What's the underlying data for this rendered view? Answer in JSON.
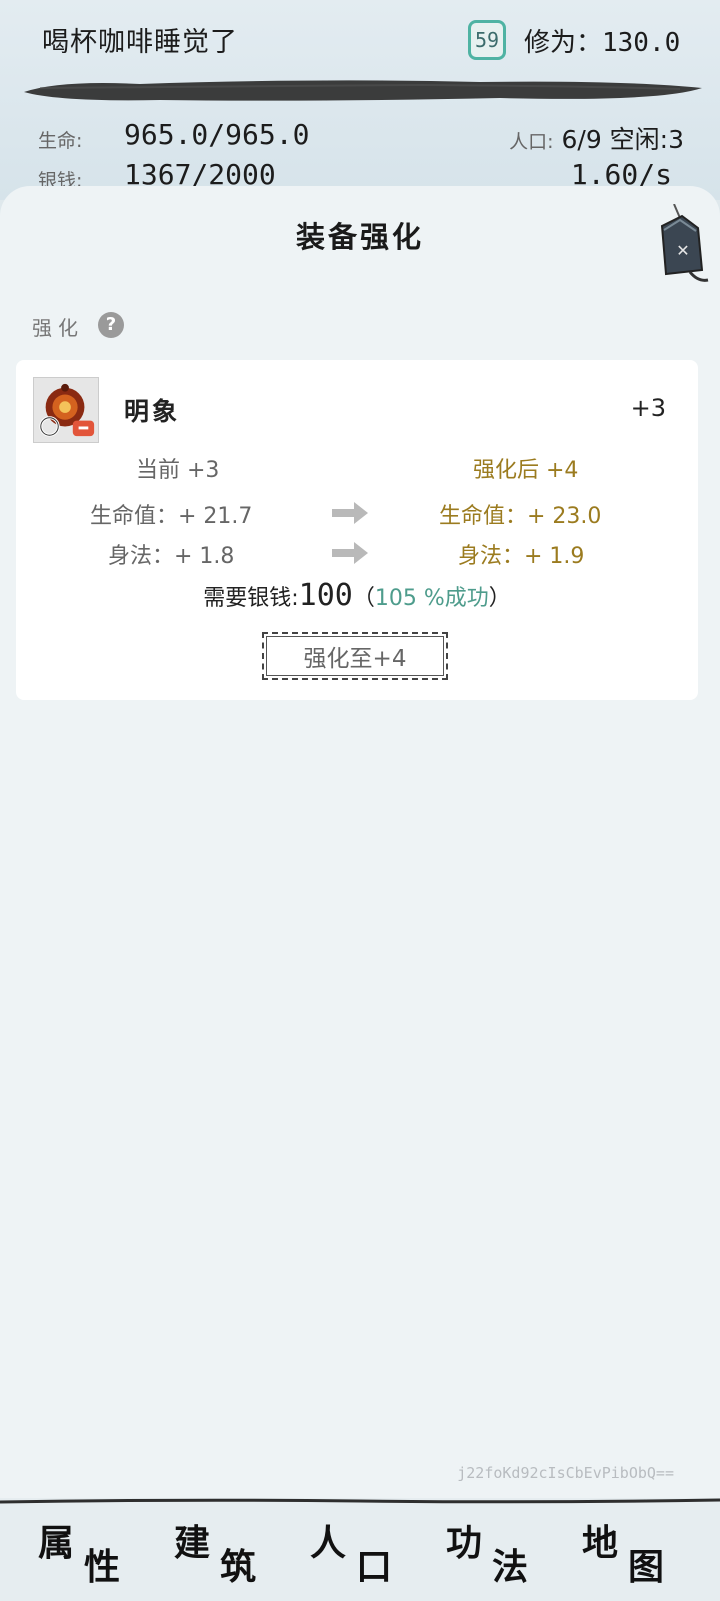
{
  "header": {
    "player_name": "喝杯咖啡睡觉了",
    "level": "59",
    "cultivation": "修为：130.0",
    "life_label": "生命:",
    "life_value": "965.0/965.0",
    "silver_label": "银钱:",
    "silver_value": "1367/2000",
    "population_label": "人口:",
    "population_value": "6/9 空闲:3",
    "silver_rate": "1.60/s"
  },
  "panel": {
    "title": "装备强化",
    "section_label": "强化",
    "help_glyph": "?"
  },
  "item": {
    "name": "明象",
    "level": "+3",
    "current_header": "当前 +3",
    "after_header": "强化后 +4",
    "stats": [
      {
        "current": "生命值：+ 21.7",
        "after": "生命值：+ 23.0"
      },
      {
        "current": "身法：+ 1.8",
        "after": "身法：+ 1.9"
      }
    ],
    "cost_label": "需要银钱:",
    "cost_value": "100",
    "cost_open": "（",
    "success_text": "105 %成功",
    "cost_close": "）",
    "button_label": "强化至+4"
  },
  "watermark": "j22foKd92cIsCbEvPibObQ==",
  "nav": {
    "items": [
      {
        "c1": "属",
        "c2": "性"
      },
      {
        "c1": "建",
        "c2": "筑"
      },
      {
        "c1": "人",
        "c2": "口"
      },
      {
        "c1": "功",
        "c2": "法"
      },
      {
        "c1": "地",
        "c2": "图"
      }
    ]
  },
  "colors": {
    "accent_gold": "#9b7b1f",
    "success_teal": "#4e9c8c",
    "badge_teal": "#4fb3a3"
  },
  "icons": {
    "close": "close-tag-icon",
    "help": "help-icon",
    "arrow": "right-arrow-icon",
    "item": "equipment-icon"
  }
}
